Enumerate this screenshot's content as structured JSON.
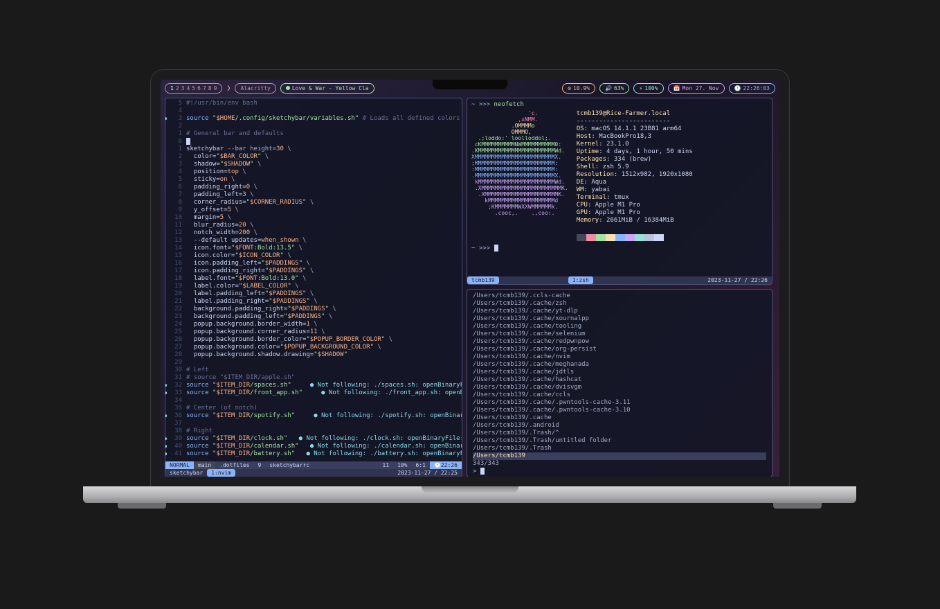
{
  "menubar": {
    "spaces": [
      "1",
      "2",
      "3",
      "4",
      "5",
      "6",
      "7",
      "8",
      "9"
    ],
    "active_space": 0,
    "chevron": "❯",
    "app": "Alacritty",
    "music": "Love & War - Yellow Cla",
    "cpu": "10.9%",
    "volume": "63%",
    "battery": "100%",
    "date": "Mon 27. Nov",
    "time": "22:26:03"
  },
  "editor": {
    "lines": [
      {
        "n": "5",
        "cls": "",
        "html": "<span class='c-cmt'>#!/usr/bin/env bash</span>"
      },
      {
        "n": "4",
        "cls": "",
        "html": ""
      },
      {
        "n": "3",
        "cls": "warn",
        "html": "<span class='c-kw'>source</span> <span class='c-str'>\"</span><span class='c-var'>$HOME</span><span class='c-str'>/.config/sketchybar/variables.sh\"</span> <span class='c-cmt'># Loads all defined colors</span>   <span class='c-warn'>● Not f</span>"
      },
      {
        "n": "2",
        "cls": "",
        "html": ""
      },
      {
        "n": "1",
        "cls": "",
        "html": "<span class='c-cmt'># General bar and defaults</span>"
      },
      {
        "n": "6",
        "cls": "",
        "html": "<span class='cursor'></span>"
      },
      {
        "n": "1",
        "cls": "",
        "html": "<span class='c-prop'>sketchybar</span> --bar height=<span class='c-var'>30</span> \\"
      },
      {
        "n": "2",
        "cls": "",
        "html": "  <span class='c-prop'>color=</span><span class='c-str'>\"</span><span class='c-var'>$BAR_COLOR</span><span class='c-str'>\"</span> \\"
      },
      {
        "n": "3",
        "cls": "",
        "html": "  <span class='c-prop'>shadow=</span><span class='c-str'>\"</span><span class='c-var'>$SHADOW</span><span class='c-str'>\"</span> \\"
      },
      {
        "n": "4",
        "cls": "",
        "html": "  <span class='c-prop'>position=</span><span class='c-var'>top</span> \\"
      },
      {
        "n": "5",
        "cls": "",
        "html": "  <span class='c-prop'>sticky=</span><span class='c-var'>on</span> \\"
      },
      {
        "n": "6",
        "cls": "",
        "html": "  <span class='c-prop'>padding_right=</span><span class='c-var'>0</span> \\"
      },
      {
        "n": "7",
        "cls": "",
        "html": "  <span class='c-prop'>padding_left=</span><span class='c-var'>3</span> \\"
      },
      {
        "n": "8",
        "cls": "",
        "html": "  <span class='c-prop'>corner_radius=</span><span class='c-str'>\"</span><span class='c-var'>$CORNER_RADIUS</span><span class='c-str'>\"</span> \\"
      },
      {
        "n": "9",
        "cls": "",
        "html": "  <span class='c-prop'>y_offset=</span><span class='c-var'>5</span> \\"
      },
      {
        "n": "10",
        "cls": "",
        "html": "  <span class='c-prop'>margin=</span><span class='c-var'>5</span> \\"
      },
      {
        "n": "11",
        "cls": "",
        "html": "  <span class='c-prop'>blur_radius=</span><span class='c-var'>20</span> \\"
      },
      {
        "n": "12",
        "cls": "",
        "html": "  <span class='c-prop'>notch_width=</span><span class='c-var'>200</span> \\"
      },
      {
        "n": "13",
        "cls": "",
        "html": "  <span class='c-prop'>--default updates=</span><span class='c-var'>when_shown</span> \\"
      },
      {
        "n": "14",
        "cls": "",
        "html": "  <span class='c-prop'>icon.font=</span><span class='c-str'>\"</span><span class='c-var'>$FONT</span><span class='c-str'>:Bold:13.5\"</span> \\"
      },
      {
        "n": "15",
        "cls": "",
        "html": "  <span class='c-prop'>icon.color=</span><span class='c-str'>\"</span><span class='c-var'>$ICON_COLOR</span><span class='c-str'>\"</span> \\"
      },
      {
        "n": "16",
        "cls": "",
        "html": "  <span class='c-prop'>icon.padding_left=</span><span class='c-str'>\"</span><span class='c-var'>$PADDINGS</span><span class='c-str'>\"</span> \\"
      },
      {
        "n": "17",
        "cls": "",
        "html": "  <span class='c-prop'>icon.padding_right=</span><span class='c-str'>\"</span><span class='c-var'>$PADDINGS</span><span class='c-str'>\"</span> \\"
      },
      {
        "n": "18",
        "cls": "",
        "html": "  <span class='c-prop'>label.font=</span><span class='c-str'>\"</span><span class='c-var'>$FONT</span><span class='c-str'>:Bold:13.0\"</span> \\"
      },
      {
        "n": "19",
        "cls": "",
        "html": "  <span class='c-prop'>label.color=</span><span class='c-str'>\"</span><span class='c-var'>$LABEL_COLOR</span><span class='c-str'>\"</span> \\"
      },
      {
        "n": "20",
        "cls": "",
        "html": "  <span class='c-prop'>label.padding_left=</span><span class='c-str'>\"</span><span class='c-var'>$PADDINGS</span><span class='c-str'>\"</span> \\"
      },
      {
        "n": "21",
        "cls": "",
        "html": "  <span class='c-prop'>label.padding_right=</span><span class='c-str'>\"</span><span class='c-var'>$PADDINGS</span><span class='c-str'>\"</span> \\"
      },
      {
        "n": "22",
        "cls": "",
        "html": "  <span class='c-prop'>background.padding_right=</span><span class='c-str'>\"</span><span class='c-var'>$PADDINGS</span><span class='c-str'>\"</span> \\"
      },
      {
        "n": "23",
        "cls": "",
        "html": "  <span class='c-prop'>background.padding_left=</span><span class='c-str'>\"</span><span class='c-var'>$PADDINGS</span><span class='c-str'>\"</span> \\"
      },
      {
        "n": "24",
        "cls": "",
        "html": "  <span class='c-prop'>popup.background.border_width=</span><span class='c-var'>1</span> \\"
      },
      {
        "n": "25",
        "cls": "",
        "html": "  <span class='c-prop'>popup.background.corner_radius=</span><span class='c-var'>11</span> \\"
      },
      {
        "n": "26",
        "cls": "",
        "html": "  <span class='c-prop'>popup.background.border_color=</span><span class='c-str'>\"</span><span class='c-var'>$POPUP_BORDER_COLOR</span><span class='c-str'>\"</span> \\"
      },
      {
        "n": "27",
        "cls": "",
        "html": "  <span class='c-prop'>popup.background.color=</span><span class='c-str'>\"</span><span class='c-var'>$POPUP_BACKGROUND_COLOR</span><span class='c-str'>\"</span> \\"
      },
      {
        "n": "28",
        "cls": "",
        "html": "  <span class='c-prop'>popup.background.shadow.drawing=</span><span class='c-str'>\"</span><span class='c-var'>$SHADOW</span><span class='c-str'>\"</span>"
      },
      {
        "n": "29",
        "cls": "",
        "html": ""
      },
      {
        "n": "30",
        "cls": "",
        "html": "<span class='c-cmt'># Left</span>"
      },
      {
        "n": "31",
        "cls": "",
        "html": "<span class='c-cmt'># source \"$ITEM_DIR/apple.sh\"</span>"
      },
      {
        "n": "32",
        "cls": "warn",
        "html": "<span class='c-kw'>source</span> <span class='c-str'>\"</span><span class='c-var'>$ITEM_DIR</span><span class='c-str'>/spaces.sh\"</span>     <span class='c-warn'>● Not following: ./spaces.sh: openBinaryFile: does n</span>"
      },
      {
        "n": "33",
        "cls": "warn",
        "html": "<span class='c-kw'>source</span> <span class='c-str'>\"</span><span class='c-var'>$ITEM_DIR</span><span class='c-str'>/front_app.sh\"</span>     <span class='c-warn'>● Not following: ./front_app.sh: openBinaryFile:</span>"
      },
      {
        "n": "34",
        "cls": "",
        "html": ""
      },
      {
        "n": "35",
        "cls": "",
        "html": "<span class='c-cmt'># Center (of notch)</span>"
      },
      {
        "n": "36",
        "cls": "warn",
        "html": "<span class='c-kw'>source</span> <span class='c-str'>\"</span><span class='c-var'>$ITEM_DIR</span><span class='c-str'>/spotify.sh\"</span>     <span class='c-warn'>● Not following: ./spotify.sh: openBinaryFile: does</span>"
      },
      {
        "n": "37",
        "cls": "",
        "html": ""
      },
      {
        "n": "38",
        "cls": "",
        "html": "<span class='c-cmt'># Right</span>"
      },
      {
        "n": "39",
        "cls": "warn",
        "html": "<span class='c-kw'>source</span> <span class='c-str'>\"</span><span class='c-var'>$ITEM_DIR</span><span class='c-str'>/clock.sh\"</span>   <span class='c-warn'>● Not following: ./clock.sh: openBinaryFile: does not</span>"
      },
      {
        "n": "40",
        "cls": "warn",
        "html": "<span class='c-kw'>source</span> <span class='c-str'>\"</span><span class='c-var'>$ITEM_DIR</span><span class='c-str'>/calendar.sh\"</span>   <span class='c-warn'>● Not following: ./calendar.sh: openBinaryFile: do</span>"
      },
      {
        "n": "41",
        "cls": "warn",
        "html": "<span class='c-kw'>source</span> <span class='c-str'>\"</span><span class='c-var'>$ITEM_DIR</span><span class='c-str'>/battery.sh\"</span>   <span class='c-warn'>● Not following: ./battery.sh: openBinaryFile: does</span>"
      }
    ],
    "status": {
      "mode": "NORMAL",
      "branch": " main",
      "folder": " .dotfiles",
      "diag": " 9",
      "filetype": " sketchybarrc",
      "lsp": " 11",
      "pct": "10%",
      "pos": "6:1",
      "clock": "22:26",
      "session": "sketchybar",
      "win": "1:nvim",
      "date": "2023-11-27 / 22:25"
    }
  },
  "neofetch": {
    "prompt": "~ >>> ",
    "cmd": "neofetch",
    "userhost": "tcmb139@Rice-Farmer.local",
    "sep": "-------------------------",
    "rows": [
      {
        "k": "OS",
        "v": "macOS 14.1.1 23B81 arm64"
      },
      {
        "k": "Host",
        "v": "MacBookPro18,3"
      },
      {
        "k": "Kernel",
        "v": "23.1.0"
      },
      {
        "k": "Uptime",
        "v": "4 days, 1 hour, 50 mins"
      },
      {
        "k": "Packages",
        "v": "334 (brew)"
      },
      {
        "k": "Shell",
        "v": "zsh 5.9"
      },
      {
        "k": "Resolution",
        "v": "1512x982, 1920x1080"
      },
      {
        "k": "DE",
        "v": "Aqua"
      },
      {
        "k": "WM",
        "v": "yabai"
      },
      {
        "k": "Terminal",
        "v": "tmux"
      },
      {
        "k": "CPU",
        "v": "Apple M1 Pro"
      },
      {
        "k": "GPU",
        "v": "Apple M1 Pro"
      },
      {
        "k": "Memory",
        "v": "2661MiB / 16384MiB"
      }
    ],
    "logo": "                 'c.\n              ,xNMM.\n            .OMMMMo\n            OMMMO,\n  .;loddo:' loolloddol;.\n cKMMMMMMMMMMNWMMMMMMMMMM0:\n.KMMMMMMMMMMMMMMMMMMMMMMMWd.\nXMMMMMMMMMMMMMMMMMMMMMMMMX.\n;MMMMMMMMMMMMMMMMMMMMMMMM:\n:MMMMMMMMMMMMMMMMMMMMMMMM:\n.MMMMMMMMMMMMMMMMMMMMMMMMX.\n kMMMMMMMMMMMMMMMMMMMMMMMWd.\n .XMMMMMMMMMMMMMMMMMMMMMMMMK.\n  .XMMMMMMMMMMMMMMMMMMMMMMK.\n    kMMMMMMMMMMMMMMMMMMMMd\n     ;KMMMMMMMWXXWMMMMMMk.\n       .cooc,.    .,coo:.",
    "swatches": [
      "#45475a",
      "#f38ba8",
      "#a6e3a1",
      "#f9e2af",
      "#89b4fa",
      "#cba6f7",
      "#94e2d5",
      "#bac2de",
      "#cdd6f4"
    ],
    "prompt2": "~ >>> ",
    "tmux": {
      "session": "tcmb139",
      "win": "1:zsh",
      "date": "2023-11-27 / 22:26"
    }
  },
  "files": {
    "entries": [
      "/Users/tcmb139/.ccls-cache",
      "/Users/tcmb139/.cache/zsh",
      "/Users/tcmb139/.cache/yt-dlp",
      "/Users/tcmb139/.cache/xournalpp",
      "/Users/tcmb139/.cache/tooling",
      "/Users/tcmb139/.cache/selenium",
      "/Users/tcmb139/.cache/redpwnpow",
      "/Users/tcmb139/.cache/org-persist",
      "/Users/tcmb139/.cache/nvim",
      "/Users/tcmb139/.cache/meghanada",
      "/Users/tcmb139/.cache/jdtls",
      "/Users/tcmb139/.cache/hashcat",
      "/Users/tcmb139/.cache/dvisvgm",
      "/Users/tcmb139/.cache/ccls",
      "/Users/tcmb139/.cache/.pwntools-cache-3.11",
      "/Users/tcmb139/.cache/.pwntools-cache-3.10",
      "/Users/tcmb139/.cache",
      "/Users/tcmb139/.android",
      "/Users/tcmb139/.Trash/^",
      "/Users/tcmb139/.Trash/untitled folder",
      "/Users/tcmb139/.Trash",
      "/Users/tcmb139"
    ],
    "counter": "343/343",
    "prompt": "> "
  }
}
